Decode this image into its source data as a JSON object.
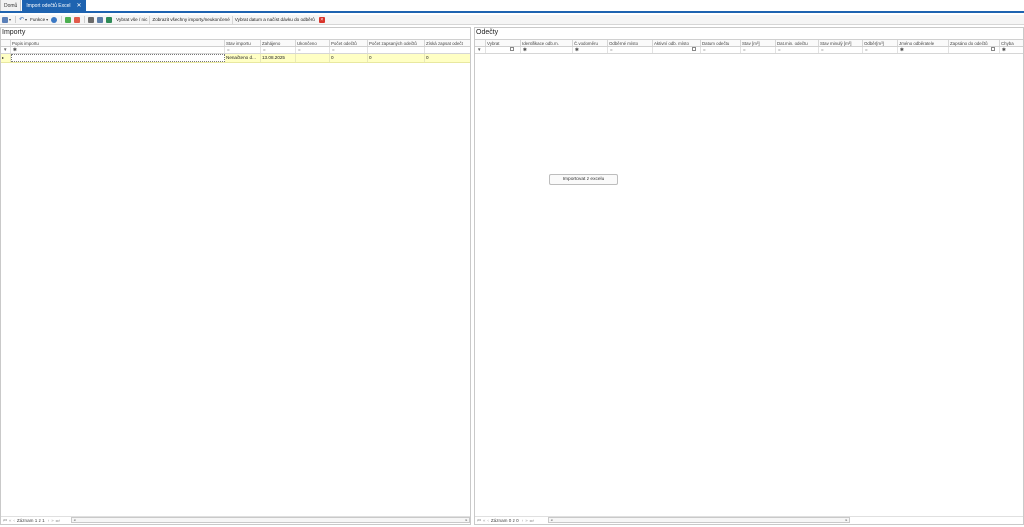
{
  "tabs": [
    {
      "label": "Domů",
      "active": false
    },
    {
      "label": "Import odečtů Excel",
      "active": true
    }
  ],
  "toolbar": {
    "functions_label": "Funkce",
    "select_all": "Vybrat vše / nic",
    "show_all_imports": "Zobrazit všechny importy/neukončené",
    "select_date": "Vybrat datum a načíst dávku do odběrů"
  },
  "imports_panel": {
    "title": "Importy",
    "columns": [
      "Popis importu",
      "Stav importu",
      "Zahájeno",
      "Ukončeno",
      "Počet odečtů",
      "Počet zapsaných odečtů",
      "Získá zapsat odečt"
    ],
    "filter_values": [
      "",
      "=",
      "=",
      "=",
      "=",
      "",
      ""
    ],
    "rows": [
      [
        "",
        "Nenačteno d...",
        "13.08.2025",
        "",
        "0",
        "0",
        "0"
      ]
    ],
    "status": "Záznam 1 z 1"
  },
  "readings_panel": {
    "title": "Odečty",
    "columns": [
      "Vybrat",
      "Identifikace odb.m.",
      "Č.vodoměru",
      "Odběrné místo",
      "Aktivní odb. místo",
      "Datum odečtu",
      "Stav [m³]",
      "Dat.min. odečtu",
      "Stav minulý [m³]",
      "Odběr[m³]",
      "Jméno odběratele",
      "Zapsáno do odečtů",
      "Chyba"
    ],
    "status": "Záznam 0 z 0",
    "import_button": "Importovat z excelu"
  },
  "colors": {
    "accent": "#1e63b0",
    "row_highlight": "#ffffc4"
  }
}
